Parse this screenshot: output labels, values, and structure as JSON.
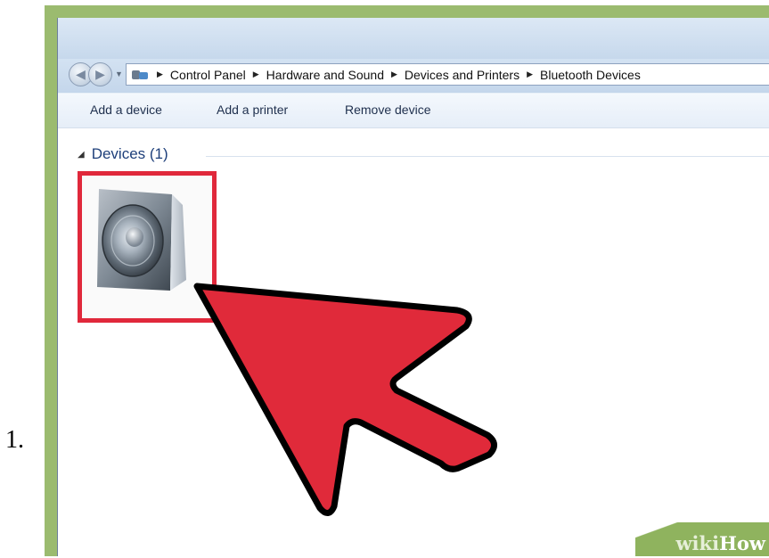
{
  "step": {
    "number": "1."
  },
  "window": {
    "breadcrumb": [
      "Control Panel",
      "Hardware and Sound",
      "Devices and Printers",
      "Bluetooth Devices"
    ],
    "commands": {
      "add_device": "Add a device",
      "add_printer": "Add a printer",
      "remove_device": "Remove device"
    },
    "group": {
      "label": "Devices (1)"
    },
    "device": {
      "icon": "speaker-icon",
      "highlight_color": "#e0283b"
    }
  },
  "annotation": {
    "arrow_color": "#e02a3a",
    "arrow_outline": "#000000"
  },
  "watermark": {
    "part1": "wiki",
    "part2": "How"
  },
  "colors": {
    "frame": "#9bbb6f",
    "command_text": "#1e2f4d",
    "group_text": "#1e3f7a"
  }
}
